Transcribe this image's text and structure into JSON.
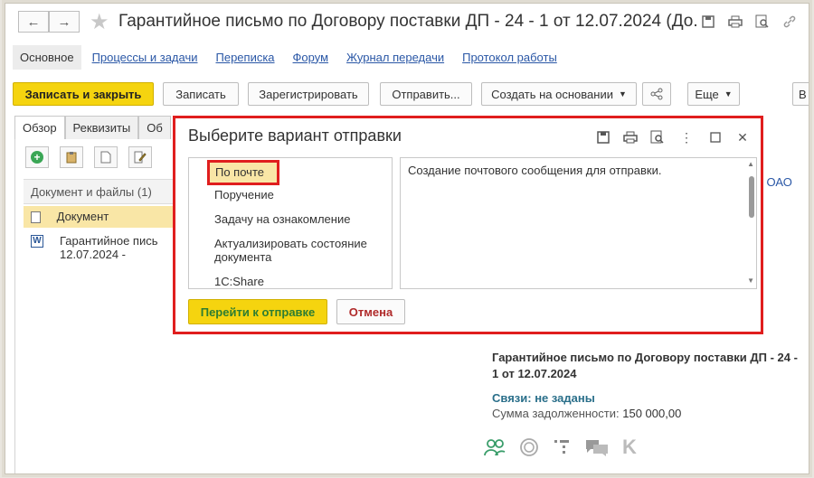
{
  "window": {
    "title": "Гарантийное письмо по Договору поставки ДП - 24 - 1 от 12.07.2024 (До...",
    "back_glyph": "←",
    "forward_glyph": "→"
  },
  "nav_tabs": {
    "active": "Основное",
    "links": [
      "Процессы и задачи",
      "Переписка",
      "Форум",
      "Журнал передачи",
      "Протокол работы"
    ]
  },
  "toolbar": {
    "save_close": "Записать и закрыть",
    "save": "Записать",
    "register": "Зарегистрировать",
    "send": "Отправить...",
    "create_based": "Создать на основании",
    "more": "Еще",
    "overflow": "В"
  },
  "left_tabs": [
    "Обзор",
    "Реквизиты",
    "Об"
  ],
  "documents": {
    "header": "Документ и файлы (1)",
    "row1": "Документ",
    "row2_line1": "Гарантийное пись",
    "row2_line2": "12.07.2024 -"
  },
  "right_panel": {
    "company_fragment": "нг ОАО",
    "doc_title_line1": "Гарантийное письмо по Договору поставки ДП - 24 -",
    "doc_title_line2": "1 от 12.07.2024",
    "links_label": "Связи: не заданы",
    "debt_label": "Сумма задолженности:",
    "debt_value": "150 000,00"
  },
  "dialog": {
    "title": "Выберите вариант отправки",
    "options": [
      "По почте",
      "Поручение",
      "Задачу на ознакомление",
      "Актуализировать состояние документа",
      "1С:Share"
    ],
    "selected": "По почте",
    "description": "Создание почтового сообщения для отправки.",
    "go_button": "Перейти к отправке",
    "cancel_button": "Отмена"
  },
  "colors": {
    "accent_yellow": "#f5d40f",
    "highlight_red": "#e01e1e",
    "link_blue": "#2a57a6",
    "selection": "#f9e6a6",
    "green_text": "#2e7d32",
    "cancel_red": "#b02a2a"
  }
}
